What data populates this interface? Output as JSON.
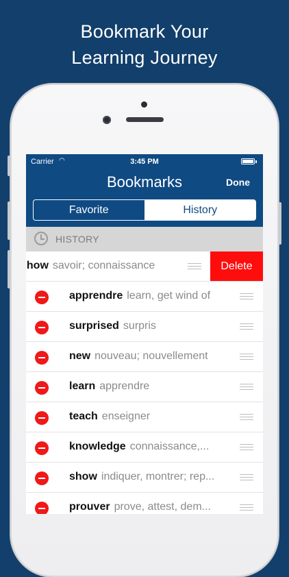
{
  "headline": {
    "line1": "Bookmark Your",
    "line2": "Learning Journey"
  },
  "status_bar": {
    "carrier": "Carrier",
    "time": "3:45 PM"
  },
  "nav": {
    "title": "Bookmarks",
    "done_label": "Done"
  },
  "segments": {
    "favorite": "Favorite",
    "history": "History",
    "selected": "History"
  },
  "section": {
    "label": "HISTORY",
    "icon": "clock-icon"
  },
  "swiped_row": {
    "word": "show",
    "meaning": "savoir; connaissance",
    "delete_label": "Delete"
  },
  "rows": [
    {
      "word": "apprendre",
      "meaning": "learn, get wind of"
    },
    {
      "word": "surprised",
      "meaning": "surpris"
    },
    {
      "word": "new",
      "meaning": "nouveau; nouvellement"
    },
    {
      "word": "learn",
      "meaning": "apprendre"
    },
    {
      "word": "teach",
      "meaning": "enseigner"
    },
    {
      "word": "knowledge",
      "meaning": "connaissance,..."
    },
    {
      "word": "show",
      "meaning": "indiquer, montrer; rep..."
    },
    {
      "word": "prouver",
      "meaning": "prove, attest, dem..."
    }
  ],
  "colors": {
    "background": "#123f6b",
    "nav": "#0f4a83",
    "delete": "#ff0d0d",
    "minus": "#f01818"
  }
}
